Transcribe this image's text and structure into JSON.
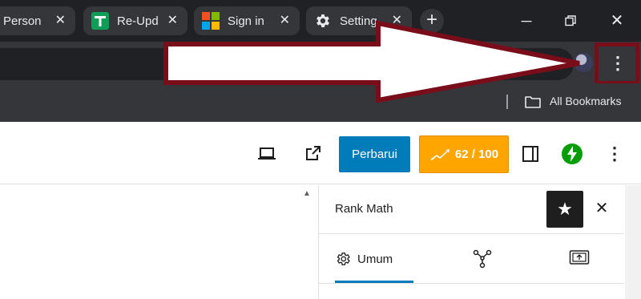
{
  "browser": {
    "tabs": [
      {
        "label": "Person",
        "favicon": "none"
      },
      {
        "label": "Re-Upd",
        "favicon": "sheets-icon"
      },
      {
        "label": "Sign in",
        "favicon": "microsoft-icon"
      },
      {
        "label": "Setting",
        "favicon": "gear-icon"
      }
    ],
    "new_tab": "+",
    "bookmarks": {
      "all_label": "All Bookmarks"
    }
  },
  "editor": {
    "update_label": "Perbarui",
    "seo_score": "62 / 100"
  },
  "sidebar": {
    "title": "Rank Math",
    "tabs": [
      {
        "label": "Umum",
        "icon": "gear-icon",
        "active": true
      },
      {
        "label": "",
        "icon": "schema-icon"
      },
      {
        "label": "",
        "icon": "social-icon"
      }
    ]
  },
  "colors": {
    "highlight": "#7a0d1a",
    "update_button": "#007cba",
    "score_badge": "#ffa500",
    "chrome_dark": "#202124"
  }
}
